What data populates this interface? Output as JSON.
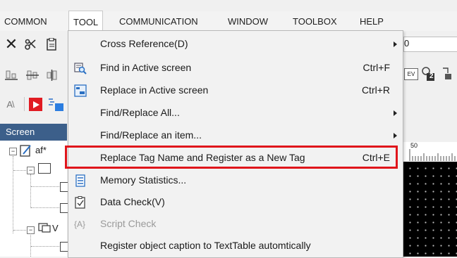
{
  "menubar": {
    "items": [
      "COMMON",
      "TOOL",
      "COMMUNICATION",
      "WINDOW",
      "TOOLBOX",
      "HELP"
    ],
    "active": "TOOL"
  },
  "toolbar": {
    "layer_label": "A",
    "field_value": "0",
    "ev_label": "EV",
    "p2_label": "2"
  },
  "screen_panel": {
    "title": "Screen",
    "root_label": "af*"
  },
  "ruler": {
    "label": "50"
  },
  "menu": {
    "items": [
      {
        "label": "Cross Reference(D)",
        "shortcut": "",
        "submenu": true,
        "icon": "",
        "disabled": false
      },
      {
        "label": "Find in Active screen",
        "shortcut": "Ctrl+F",
        "submenu": false,
        "icon": "find-icon",
        "disabled": false
      },
      {
        "label": "Replace in Active screen",
        "shortcut": "Ctrl+R",
        "submenu": false,
        "icon": "replace-icon",
        "disabled": false
      },
      {
        "label": "Find/Replace All...",
        "shortcut": "",
        "submenu": true,
        "icon": "",
        "disabled": false
      },
      {
        "label": "Find/Replace an item...",
        "shortcut": "",
        "submenu": true,
        "icon": "",
        "disabled": false
      },
      {
        "label": "Replace Tag Name and Register as a New Tag",
        "shortcut": "Ctrl+E",
        "submenu": false,
        "icon": "",
        "disabled": false,
        "highlighted": true
      },
      {
        "label": "Memory Statistics...",
        "shortcut": "",
        "submenu": false,
        "icon": "memory-icon",
        "disabled": false
      },
      {
        "label": "Data Check(V)",
        "shortcut": "",
        "submenu": false,
        "icon": "checklist-icon",
        "disabled": false
      },
      {
        "label": "Script Check",
        "shortcut": "",
        "submenu": false,
        "icon": "script-icon",
        "disabled": true
      },
      {
        "label": "Register object caption to TextTable automtically",
        "shortcut": "",
        "submenu": false,
        "icon": "",
        "disabled": false
      }
    ]
  },
  "colors": {
    "highlight_border": "#e0151b",
    "panel_header": "#3c5f8a",
    "menu_bg": "#f2f2f2"
  }
}
